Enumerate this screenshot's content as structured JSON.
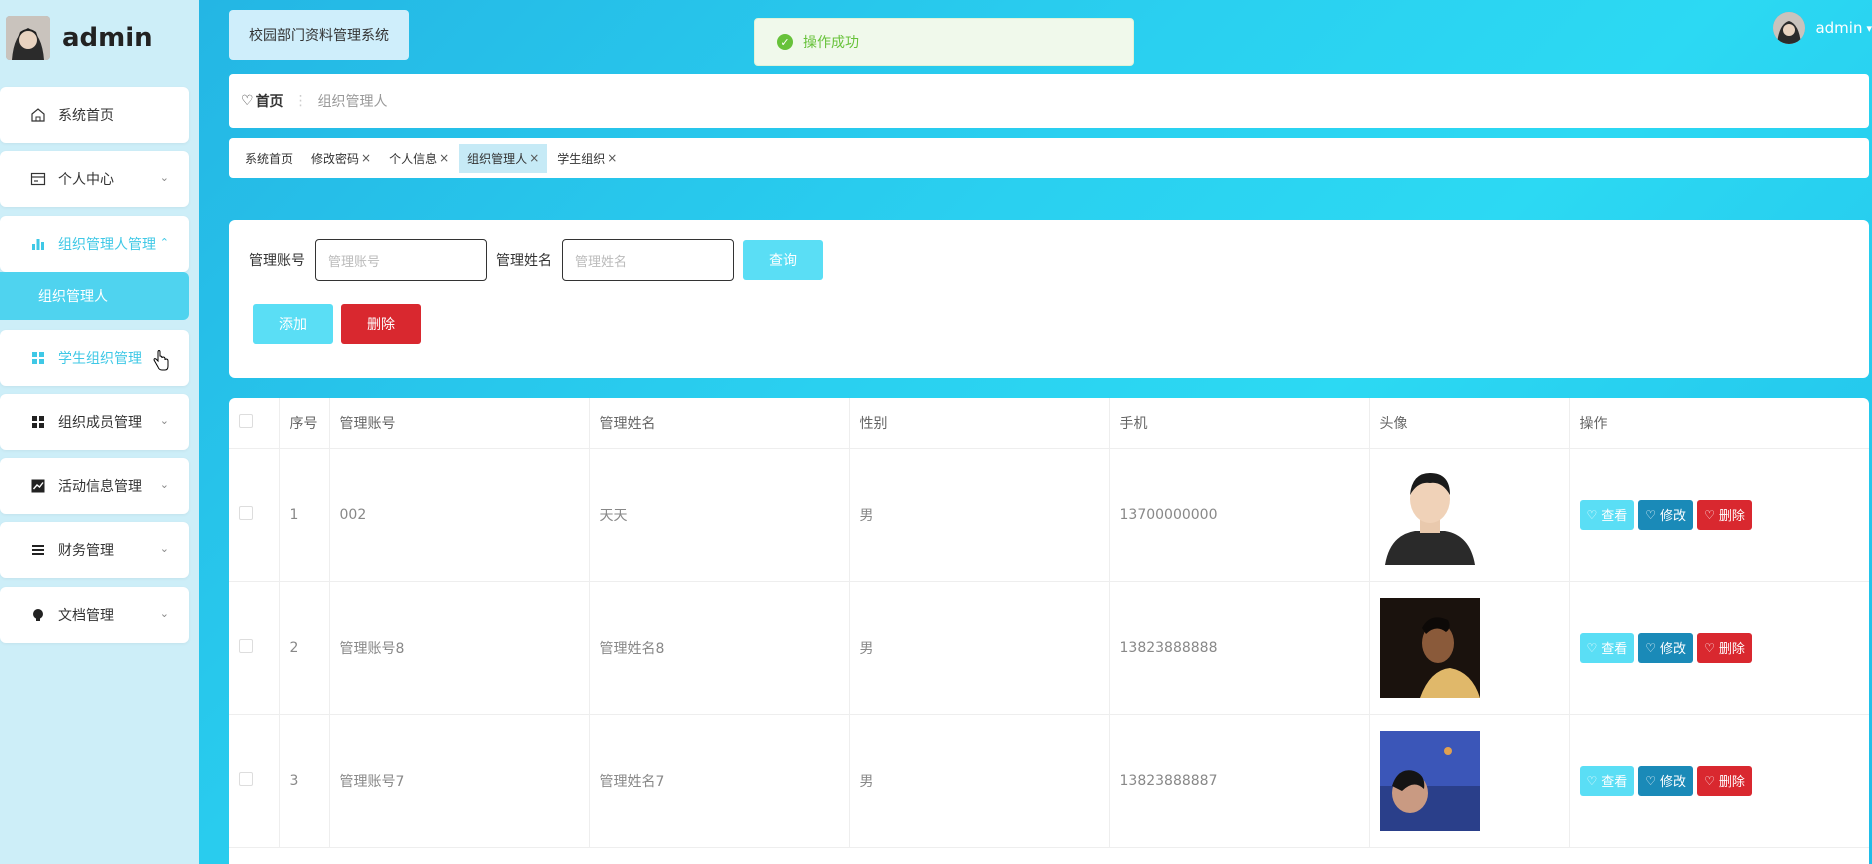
{
  "brand": {
    "name": "admin"
  },
  "sidebar": {
    "items": [
      {
        "label": "系统首页",
        "icon": "home-icon"
      },
      {
        "label": "个人中心",
        "icon": "card-icon"
      },
      {
        "label": "组织管理人管理",
        "icon": "bar-chart-icon"
      },
      {
        "label": "学生组织管理",
        "icon": "grid-icon"
      },
      {
        "label": "组织成员管理",
        "icon": "grid-icon"
      },
      {
        "label": "活动信息管理",
        "icon": "line-chart-icon"
      },
      {
        "label": "财务管理",
        "icon": "list-icon"
      },
      {
        "label": "文档管理",
        "icon": "bulb-icon"
      }
    ],
    "active_sub": "组织管理人"
  },
  "header": {
    "system_title": "校园部门资料管理系统",
    "toast": "操作成功",
    "user": "admin"
  },
  "breadcrumb": {
    "home": "首页",
    "current": "组织管理人"
  },
  "tags": [
    {
      "label": "系统首页",
      "closable": false,
      "active": false
    },
    {
      "label": "修改密码",
      "closable": true,
      "active": false
    },
    {
      "label": "个人信息",
      "closable": true,
      "active": false
    },
    {
      "label": "组织管理人",
      "closable": true,
      "active": true
    },
    {
      "label": "学生组织",
      "closable": true,
      "active": false
    }
  ],
  "search": {
    "account_label": "管理账号",
    "account_placeholder": "管理账号",
    "name_label": "管理姓名",
    "name_placeholder": "管理姓名",
    "query": "查询",
    "add": "添加",
    "delete": "删除"
  },
  "table": {
    "columns": [
      "序号",
      "管理账号",
      "管理姓名",
      "性别",
      "手机",
      "头像",
      "操作"
    ],
    "rows": [
      {
        "index": "1",
        "account": "002",
        "name": "天天",
        "gender": "男",
        "phone": "13700000000"
      },
      {
        "index": "2",
        "account": "管理账号8",
        "name": "管理姓名8",
        "gender": "男",
        "phone": "13823888888"
      },
      {
        "index": "3",
        "account": "管理账号7",
        "name": "管理姓名7",
        "gender": "男",
        "phone": "13823888887"
      }
    ],
    "actions": {
      "view": "查看",
      "edit": "修改",
      "del": "删除"
    }
  },
  "colors": {
    "accent": "#4fd3ef",
    "danger": "#d9282f",
    "edit": "#1a8ab8",
    "success": "#67c23a"
  }
}
